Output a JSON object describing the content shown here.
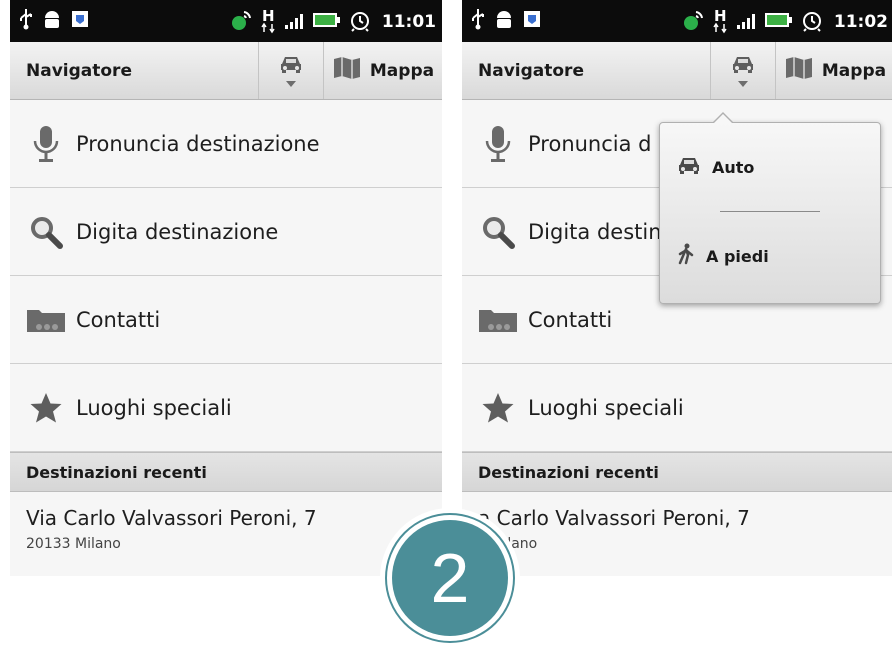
{
  "screens": [
    {
      "status": {
        "time": "11:01",
        "network": "H"
      },
      "title": "Navigatore",
      "map_label": "Mappa",
      "menu": [
        {
          "label": "Pronuncia destinazione",
          "icon": "microphone-icon"
        },
        {
          "label": "Digita destinazione",
          "icon": "search-icon"
        },
        {
          "label": "Contatti",
          "icon": "contacts-icon"
        },
        {
          "label": "Luoghi speciali",
          "icon": "star-icon"
        }
      ],
      "recent_header": "Destinazioni recenti",
      "recent": {
        "title": "Via Carlo Valvassori Peroni, 7",
        "subtitle": "20133 Milano"
      }
    },
    {
      "status": {
        "time": "11:02",
        "network": "H"
      },
      "title": "Navigatore",
      "map_label": "Mappa",
      "menu": [
        {
          "label": "Pronuncia d",
          "icon": "microphone-icon"
        },
        {
          "label": "Digita destin",
          "icon": "search-icon"
        },
        {
          "label": "Contatti",
          "icon": "contacts-icon"
        },
        {
          "label": "Luoghi speciali",
          "icon": "star-icon"
        }
      ],
      "recent_header": "Destinazioni recenti",
      "recent": {
        "title": "a Carlo Valvassori Peroni, 7",
        "subtitle": "3 Milano"
      },
      "popup": {
        "items": [
          {
            "label": "Auto",
            "icon": "car-icon"
          },
          {
            "label": "A piedi",
            "icon": "pedestrian-icon"
          }
        ]
      }
    }
  ],
  "badge": "2",
  "colors": {
    "accent": "#4b8e98",
    "battery": "#3cb043",
    "statusbar": "#0c0c0c"
  }
}
